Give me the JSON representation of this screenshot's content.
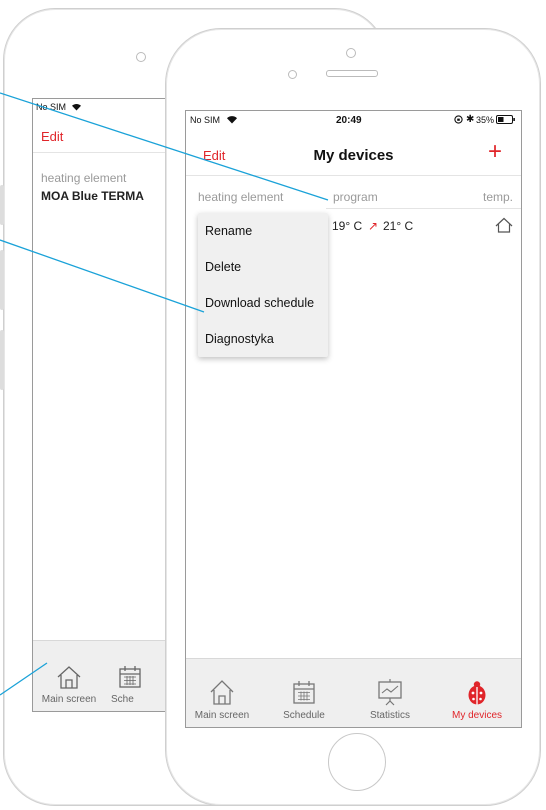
{
  "back_phone": {
    "status": {
      "carrier": "No SIM"
    },
    "edit_label": "Edit",
    "column_header": "heating element",
    "device_name": "MOA Blue TERMA",
    "tabs": [
      {
        "label": "Main screen",
        "icon": "home-icon"
      },
      {
        "label": "Sche",
        "icon": "calendar-icon"
      }
    ]
  },
  "front_phone": {
    "status": {
      "carrier": "No SIM",
      "time": "20:49",
      "battery": "35%"
    },
    "nav": {
      "edit_label": "Edit",
      "title": "My devices",
      "add_label": "+"
    },
    "columns": {
      "element": "heating element",
      "program": "program",
      "temp": "temp."
    },
    "row": {
      "program_from": "19° C",
      "arrow": "↗",
      "program_to": "21° C",
      "temp_icon": "home-outline-icon"
    },
    "context_menu": [
      "Rename",
      "Delete",
      "Download schedule",
      "Diagnostyka"
    ],
    "tabs": [
      {
        "label": "Main screen",
        "icon": "home-icon",
        "active": false
      },
      {
        "label": "Schedule",
        "icon": "calendar-icon",
        "active": false
      },
      {
        "label": "Statistics",
        "icon": "chart-board-icon",
        "active": false
      },
      {
        "label": "My devices",
        "icon": "ladybug-icon",
        "active": true
      }
    ]
  },
  "colors": {
    "accent": "#e0252a",
    "callout": "#1aa2d8",
    "tabbar": "#efefef"
  }
}
